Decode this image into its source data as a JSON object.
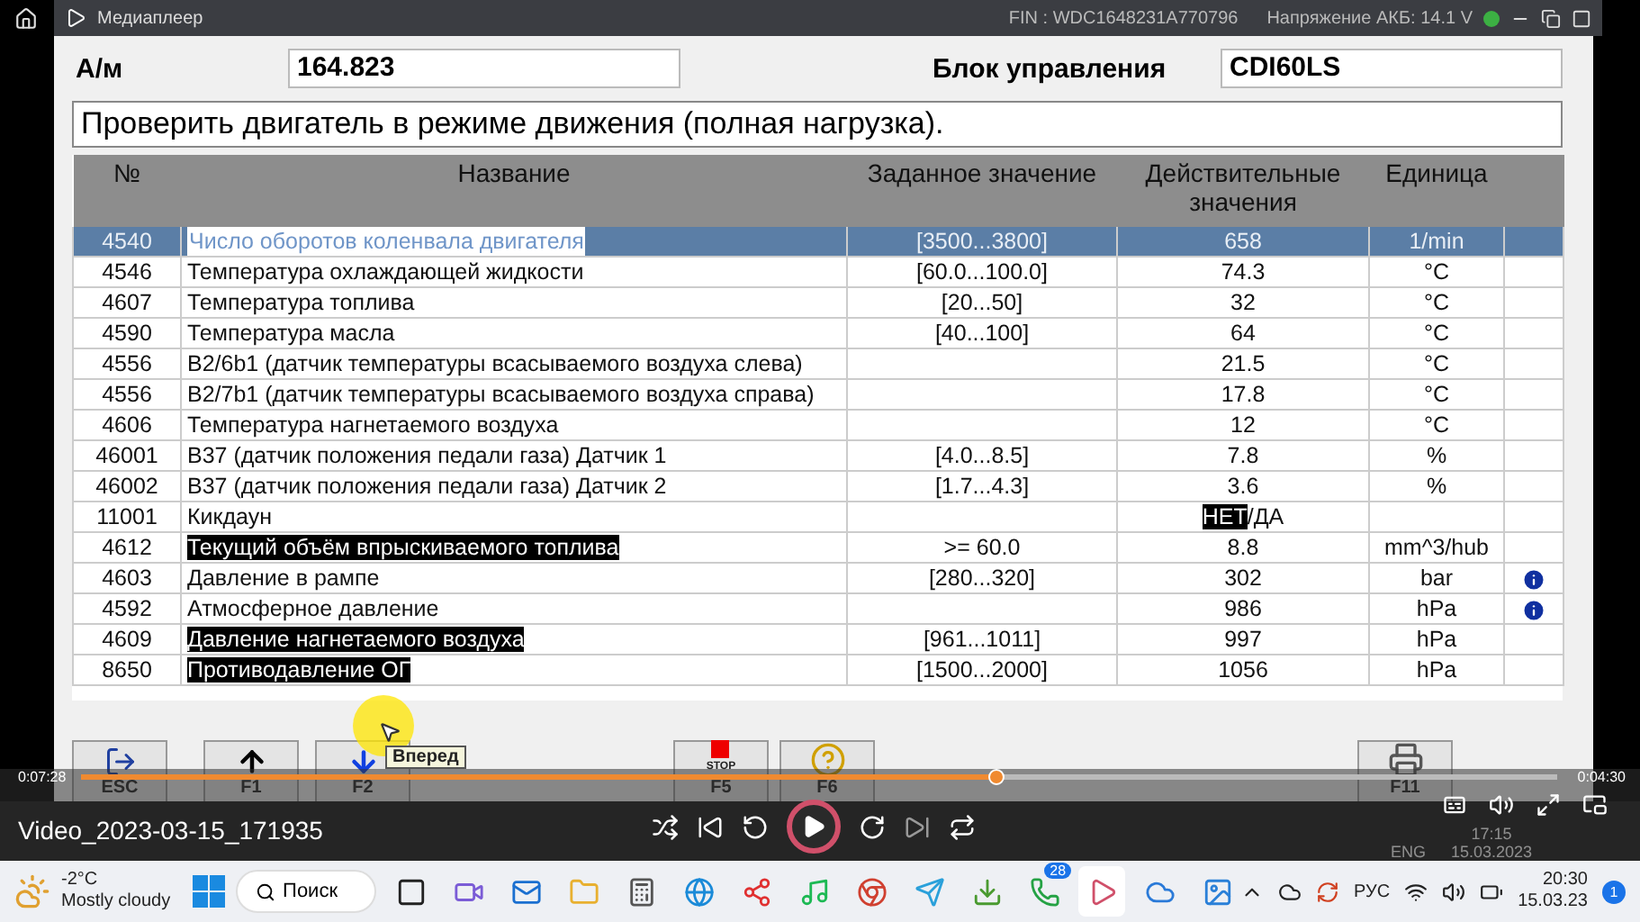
{
  "player_title_bar": {
    "title": "Медиаплеер",
    "fin": "FIN : WDC1648231A770796",
    "voltage": "Напряжение АКБ: 14.1 V",
    "status_ok": true
  },
  "header": {
    "vehicle_label": "А/м",
    "vehicle_value": "164.823",
    "unit_label": "Блок управления",
    "unit_value": "CDI60LS"
  },
  "instruction": "Проверить двигатель в режиме движения (полная нагрузка).",
  "table": {
    "columns": [
      "№",
      "Название",
      "Заданное значение",
      "Действительные значения",
      "Единица"
    ],
    "rows": [
      {
        "no": "4540",
        "name": "Число оборотов коленвала двигателя",
        "target": "[3500...3800]",
        "actual": "658",
        "unit": "1/min",
        "selected": true,
        "highlighted": false,
        "info": false
      },
      {
        "no": "4546",
        "name": "Температура охлаждающей жидкости",
        "target": "[60.0...100.0]",
        "actual": "74.3",
        "unit": "°C",
        "selected": false,
        "highlighted": false,
        "info": false
      },
      {
        "no": "4607",
        "name": "Температура топлива",
        "target": "[20...50]",
        "actual": "32",
        "unit": "°C",
        "selected": false,
        "highlighted": false,
        "info": false
      },
      {
        "no": "4590",
        "name": "Температура масла",
        "target": "[40...100]",
        "actual": "64",
        "unit": "°C",
        "selected": false,
        "highlighted": false,
        "info": false
      },
      {
        "no": "4556",
        "name": "B2/6b1 (датчик температуры всасываемого воздуха слева)",
        "actual": "21.5",
        "unit": "°C",
        "selected": false,
        "highlighted": false,
        "info": false
      },
      {
        "no": "4556",
        "name": "B2/7b1 (датчик температуры всасываемого воздуха справа)",
        "actual": "17.8",
        "unit": "°C",
        "selected": false,
        "highlighted": false,
        "info": false
      },
      {
        "no": "4606",
        "name": "Температура нагнетаемого воздуха",
        "actual": "12",
        "unit": "°C",
        "selected": false,
        "highlighted": false,
        "info": false
      },
      {
        "no": "46001",
        "name": "B37 (датчик положения педали газа) Датчик 1",
        "target": "[4.0...8.5]",
        "actual": "7.8",
        "unit": "%",
        "selected": false,
        "highlighted": false,
        "info": false
      },
      {
        "no": "46002",
        "name": "B37 (датчик положения педали газа) Датчик 2",
        "target": "[1.7...4.3]",
        "actual": "3.6",
        "unit": "%",
        "selected": false,
        "highlighted": false,
        "info": false
      },
      {
        "no": "11001",
        "name": "Кикдаун",
        "actual_choice": {
          "separator": "/",
          "options": [
            {
              "label": "НЕТ",
              "selected": true
            },
            {
              "label": "ДА",
              "selected": false
            }
          ]
        },
        "selected": false,
        "highlighted": false,
        "info": false
      },
      {
        "no": "4612",
        "name": "Текущий объём впрыскиваемого топлива",
        "target": ">= 60.0",
        "actual": "8.8",
        "unit": "mm^3/hub",
        "selected": false,
        "highlighted": true,
        "info": false
      },
      {
        "no": "4603",
        "name": "Давление в рампе",
        "target": "[280...320]",
        "actual": "302",
        "unit": "bar",
        "selected": false,
        "highlighted": false,
        "info": true
      },
      {
        "no": "4592",
        "name": "Атмосферное давление",
        "actual": "986",
        "unit": "hPa",
        "selected": false,
        "highlighted": false,
        "info": true
      },
      {
        "no": "4609",
        "name": "Давление нагнетаемого воздуха",
        "target": "[961...1011]",
        "actual": "997",
        "unit": "hPa",
        "selected": false,
        "highlighted": true,
        "info": false
      },
      {
        "no": "8650",
        "name": "Противодавление ОГ",
        "target": "[1500...2000]",
        "actual": "1056",
        "unit": "hPa",
        "selected": false,
        "highlighted": true,
        "info": false
      }
    ]
  },
  "function_keys": {
    "left": [
      {
        "kind": "exit",
        "label": "ESC"
      },
      {
        "kind": "up",
        "label": "F1"
      },
      {
        "kind": "down",
        "label": "F2"
      }
    ],
    "center": [
      {
        "kind": "stop",
        "caption": "STOP",
        "label": "F5"
      },
      {
        "kind": "help",
        "label": "F6"
      }
    ],
    "right": [
      {
        "kind": "print",
        "label": "F11"
      }
    ]
  },
  "tooltip": "Вперед",
  "background_taskbar": {
    "language": "ENG",
    "time": "17:15",
    "date": "15.03.2023"
  },
  "video_player": {
    "elapsed": "0:07:28",
    "remaining": "0:04:30",
    "level": 0.62,
    "file_name": "Video_2023-03-15_171935",
    "playing": false
  },
  "taskbar": {
    "temperature": "-2°C",
    "weather": "Mostly cloudy",
    "search": "Поиск",
    "apps": [
      {
        "kind": "square",
        "selected": false
      },
      {
        "kind": "video",
        "selected": false
      },
      {
        "kind": "mail",
        "selected": false
      },
      {
        "kind": "folder",
        "selected": false
      },
      {
        "kind": "calculator",
        "selected": false
      },
      {
        "kind": "globe",
        "selected": false
      },
      {
        "kind": "share",
        "selected": false
      },
      {
        "kind": "music",
        "selected": false
      },
      {
        "kind": "chrome",
        "selected": false
      },
      {
        "kind": "send",
        "selected": false
      },
      {
        "kind": "download",
        "selected": false
      },
      {
        "kind": "phone",
        "selected": false,
        "badge": "28"
      },
      {
        "kind": "player",
        "selected": true
      },
      {
        "kind": "cloud",
        "selected": false
      },
      {
        "kind": "image",
        "selected": false
      }
    ],
    "language": "РУС",
    "time": "20:30",
    "date": "15.03.23",
    "notifications": "1"
  }
}
